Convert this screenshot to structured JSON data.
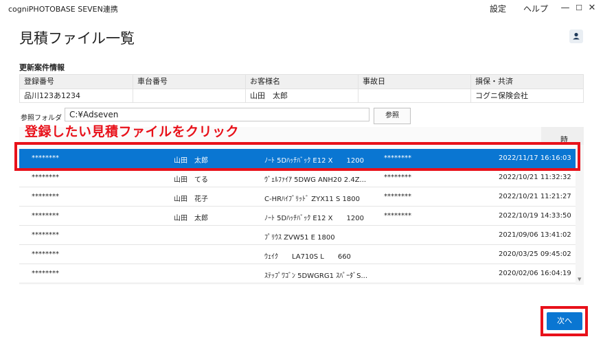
{
  "window": {
    "title": "cogniPHOTOBASE SEVEN連携",
    "menu": [
      "設定",
      "ヘルプ"
    ],
    "controls": {
      "minimize": "—",
      "maximize": "☐",
      "close": "✕"
    }
  },
  "page": {
    "title": "見積ファイル一覧"
  },
  "update_info": {
    "label": "更新案件情報",
    "headers": [
      "登録番号",
      "車台番号",
      "お客様名",
      "事故日",
      "損保・共済"
    ],
    "values": [
      "品川123あ1234",
      "",
      "山田　太郎",
      "",
      "コグニ保険会社"
    ]
  },
  "folder": {
    "label": "参照フォルダ",
    "value": "C:¥Adseven",
    "browse_label": "参照"
  },
  "annotation": "登録したい見積ファイルをクリック",
  "list": {
    "header_partial": "時",
    "rows": [
      {
        "id": "********",
        "name": "山田　太郎",
        "car": "ﾉｰﾄ 5Dﾊｯﾁﾊﾞｯｸ E12 X　　1200",
        "id2": "********",
        "date": "2022/11/17 16:16:03",
        "selected": true
      },
      {
        "id": "********",
        "name": "山田　てる",
        "car": "ｳﾞｪﾙﾌｧｲｱ 5DWG ANH20 2.4Z...",
        "id2": "********",
        "date": "2022/10/21 11:32:32",
        "selected": false
      },
      {
        "id": "********",
        "name": "山田　花子",
        "car": "C-HRﾊｲﾌﾞﾘｯﾄﾞ ZYX11 S 1800",
        "id2": "********",
        "date": "2022/10/21 11:21:27",
        "selected": false
      },
      {
        "id": "********",
        "name": "山田　太郎",
        "car": "ﾉｰﾄ 5Dﾊｯﾁﾊﾞｯｸ E12 X　　1200",
        "id2": "********",
        "date": "2022/10/19 14:33:50",
        "selected": false
      },
      {
        "id": "********",
        "name": "",
        "car": "ﾌﾟﾘｳｽ ZVW51 E 1800",
        "id2": "",
        "date": "2021/09/06 13:41:02",
        "selected": false
      },
      {
        "id": "********",
        "name": "",
        "car": "ｳｪｲｸ　　LA710S L　　660",
        "id2": "",
        "date": "2020/03/25 09:45:02",
        "selected": false
      },
      {
        "id": "********",
        "name": "",
        "car": "ｽﾃｯﾌﾟﾜｺﾞﾝ 5DWGRG1 ｽﾊﾟｰﾀﾞS...",
        "id2": "",
        "date": "2020/02/06 16:04:19",
        "selected": false
      }
    ]
  },
  "footer": {
    "next_label": "次へ"
  },
  "colors": {
    "accent": "#0a76d2",
    "annotation": "#e8111a"
  }
}
